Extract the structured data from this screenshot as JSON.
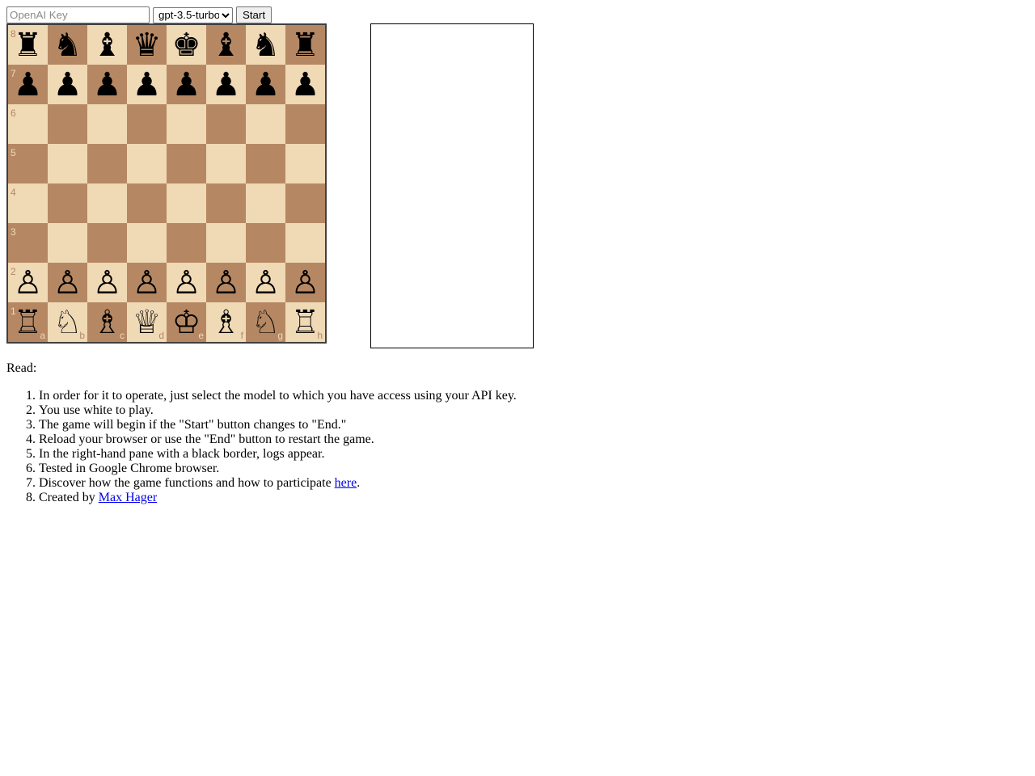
{
  "controls": {
    "api_key_placeholder": "OpenAI Key",
    "api_key_value": "",
    "model_selected": "gpt-3.5-turbo",
    "start_label": "Start"
  },
  "board": {
    "colors": {
      "light": "#f0d9b5",
      "dark": "#b58863",
      "border": "#404040"
    },
    "ranks": [
      "8",
      "7",
      "6",
      "5",
      "4",
      "3",
      "2",
      "1"
    ],
    "files": [
      "a",
      "b",
      "c",
      "d",
      "e",
      "f",
      "g",
      "h"
    ],
    "rows": [
      [
        "r",
        "n",
        "b",
        "q",
        "k",
        "b",
        "n",
        "r"
      ],
      [
        "p",
        "p",
        "p",
        "p",
        "p",
        "p",
        "p",
        "p"
      ],
      [
        "",
        "",
        "",
        "",
        "",
        "",
        "",
        ""
      ],
      [
        "",
        "",
        "",
        "",
        "",
        "",
        "",
        ""
      ],
      [
        "",
        "",
        "",
        "",
        "",
        "",
        "",
        ""
      ],
      [
        "",
        "",
        "",
        "",
        "",
        "",
        "",
        ""
      ],
      [
        "P",
        "P",
        "P",
        "P",
        "P",
        "P",
        "P",
        "P"
      ],
      [
        "R",
        "N",
        "B",
        "Q",
        "K",
        "B",
        "N",
        "R"
      ]
    ]
  },
  "log": {
    "lines": []
  },
  "read": {
    "label": "Read:",
    "items": [
      "In order for it to operate, just select the model to which you have access using your API key.",
      "You use white to play.",
      "The game will begin if the \"Start\" button changes to \"End.\"",
      "Reload your browser or use the \"End\" button to restart the game.",
      "In the right-hand pane with a black border, logs appear.",
      "Tested in Google Chrome browser."
    ],
    "discover_text": "Discover how the game functions and how to participate ",
    "discover_link": "here",
    "discover_suffix": ".",
    "created_text": "Created by ",
    "author_link": "Max Hager"
  }
}
